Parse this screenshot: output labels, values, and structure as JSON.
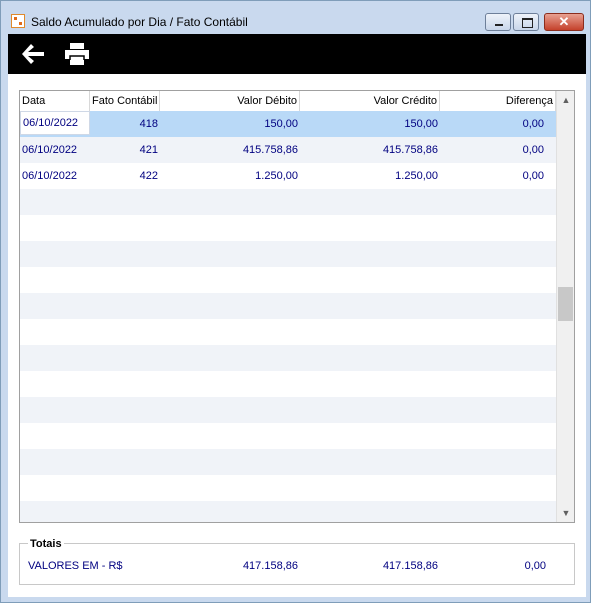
{
  "window": {
    "title": "Saldo Acumulado por Dia / Fato Contábil",
    "close_label": "✕"
  },
  "toolbar": {
    "back_icon": "back-arrow-icon",
    "print_icon": "printer-icon"
  },
  "grid": {
    "columns": [
      "Data",
      "Fato Contábil",
      "Valor Débito",
      "Valor Crédito",
      "Diferença"
    ],
    "rows": [
      {
        "data": "06/10/2022",
        "fato": "418",
        "debito": "150,00",
        "credito": "150,00",
        "diferenca": "0,00"
      },
      {
        "data": "06/10/2022",
        "fato": "421",
        "debito": "415.758,86",
        "credito": "415.758,86",
        "diferenca": "0,00"
      },
      {
        "data": "06/10/2022",
        "fato": "422",
        "debito": "1.250,00",
        "credito": "1.250,00",
        "diferenca": "0,00"
      }
    ],
    "selected_row": 0
  },
  "totais": {
    "title": "Totais",
    "label": "VALORES EM - R$",
    "debito": "417.158,86",
    "credito": "417.158,86",
    "diferenca": "0,00"
  },
  "colors": {
    "toolbar_bg": "#000000",
    "selected_row": "#b9d9f7",
    "text_value": "#000080"
  }
}
